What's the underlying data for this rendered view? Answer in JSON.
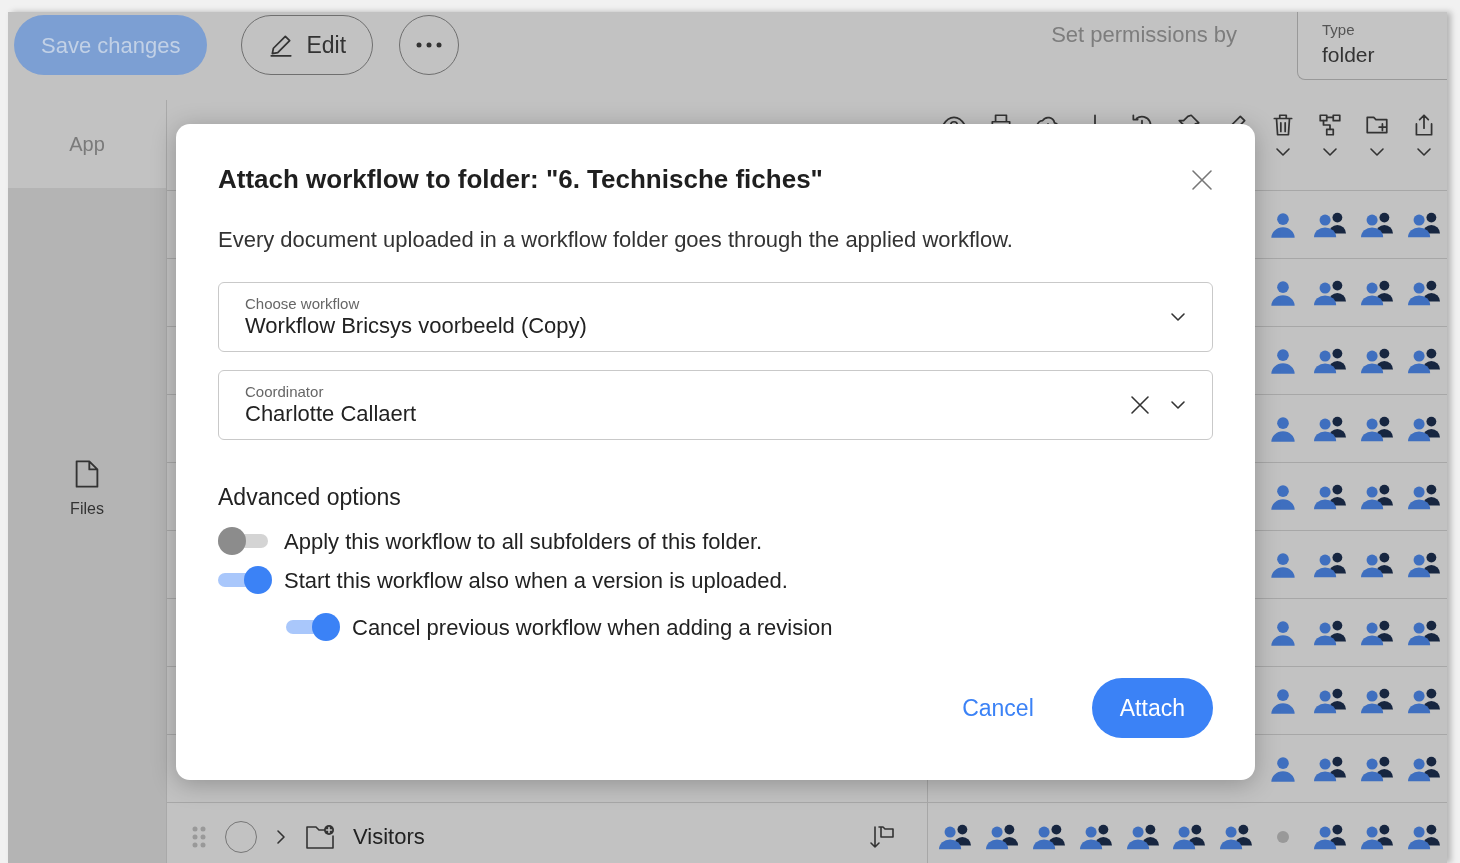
{
  "top_bar": {
    "save_button": "Save changes",
    "edit_button": "Edit",
    "permissions_label": "Set permissions by",
    "type_field": {
      "label": "Type",
      "value": "folder"
    }
  },
  "sidebar": {
    "header": "App",
    "items": [
      {
        "label": "Files"
      }
    ]
  },
  "table": {
    "rows": [
      {
        "permissions": [
          {
            "kind": "user"
          },
          {
            "kind": "group"
          },
          {
            "kind": "group"
          },
          {
            "kind": "group"
          }
        ]
      },
      {
        "permissions": [
          {
            "kind": "user"
          },
          {
            "kind": "group"
          },
          {
            "kind": "group"
          },
          {
            "kind": "group"
          }
        ]
      },
      {
        "permissions": [
          {
            "kind": "user"
          },
          {
            "kind": "group"
          },
          {
            "kind": "group"
          },
          {
            "kind": "group"
          }
        ]
      },
      {
        "permissions": [
          {
            "kind": "user"
          },
          {
            "kind": "group"
          },
          {
            "kind": "group"
          },
          {
            "kind": "group"
          }
        ]
      },
      {
        "permissions": [
          {
            "kind": "user"
          },
          {
            "kind": "group"
          },
          {
            "kind": "group"
          },
          {
            "kind": "group"
          }
        ]
      },
      {
        "permissions": [
          {
            "kind": "user"
          },
          {
            "kind": "group"
          },
          {
            "kind": "group"
          },
          {
            "kind": "group"
          }
        ]
      },
      {
        "permissions": [
          {
            "kind": "user"
          },
          {
            "kind": "group"
          },
          {
            "kind": "group"
          },
          {
            "kind": "group"
          }
        ]
      },
      {
        "permissions": [
          {
            "kind": "user"
          },
          {
            "kind": "group"
          },
          {
            "kind": "group"
          },
          {
            "kind": "group"
          }
        ]
      },
      {
        "permissions": [
          {
            "kind": "user"
          },
          {
            "kind": "group"
          },
          {
            "kind": "group"
          },
          {
            "kind": "group"
          }
        ]
      },
      {
        "name": "Visitors",
        "selected": false,
        "permissions": [
          {
            "kind": "group"
          },
          {
            "kind": "group"
          },
          {
            "kind": "group"
          },
          {
            "kind": "group"
          },
          {
            "kind": "group"
          },
          {
            "kind": "group"
          },
          {
            "kind": "group"
          },
          {
            "kind": "none"
          },
          {
            "kind": "group"
          },
          {
            "kind": "group"
          },
          {
            "kind": "group"
          }
        ]
      }
    ]
  },
  "dialog": {
    "title": "Attach workflow to folder: \"6. Technische fiches\"",
    "description": "Every document uploaded in a workflow folder goes through the applied workflow.",
    "fields": [
      {
        "label": "Choose workflow",
        "value": "Workflow Bricsys voorbeeld (Copy)",
        "clearable": false
      },
      {
        "label": "Coordinator",
        "value": "Charlotte Callaert",
        "clearable": true
      }
    ],
    "advanced_title": "Advanced options",
    "options": [
      {
        "label": "Apply this workflow to all subfolders of this folder.",
        "on": false
      },
      {
        "label": "Start this workflow also when a version is uploaded.",
        "on": true,
        "children": [
          {
            "label": "Cancel previous workflow when adding a revision",
            "on": true
          }
        ]
      }
    ],
    "cancel_button": "Cancel",
    "attach_button": "Attach"
  }
}
